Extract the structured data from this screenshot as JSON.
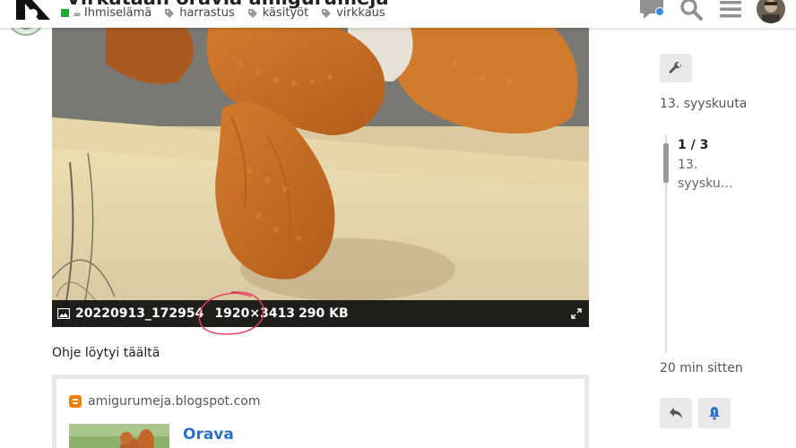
{
  "header": {
    "title": "Virkataan oravia amigurumeja",
    "category": "Ihmiselämä",
    "tags": [
      "harrastus",
      "käsityöt",
      "virkkaus"
    ],
    "icons": [
      "chat-icon",
      "search-icon",
      "hamburger-menu-icon",
      "user-avatar"
    ]
  },
  "image": {
    "filename": "20220913_172954",
    "dimensions": "1920×3413",
    "filesize": "290 KB",
    "icons": [
      "image-icon",
      "expand-icon"
    ]
  },
  "post": {
    "text": "Ohje löytyi täältä"
  },
  "onebox": {
    "source": "amigurumeja.blogspot.com",
    "title": "Orava",
    "icon": "blogger-icon"
  },
  "timeline": {
    "date_top": "13. syyskuuta",
    "position": "1 / 3",
    "position_date": "13. syysku…",
    "date_bottom": "20 min sitten",
    "icons": [
      "wrench-icon",
      "reply-icon",
      "bell-icon"
    ]
  },
  "colors": {
    "category": "#21a839",
    "link": "#2b6fc7",
    "notification_dot": "#3a8de0",
    "annotation_circle": "#e0405a"
  }
}
